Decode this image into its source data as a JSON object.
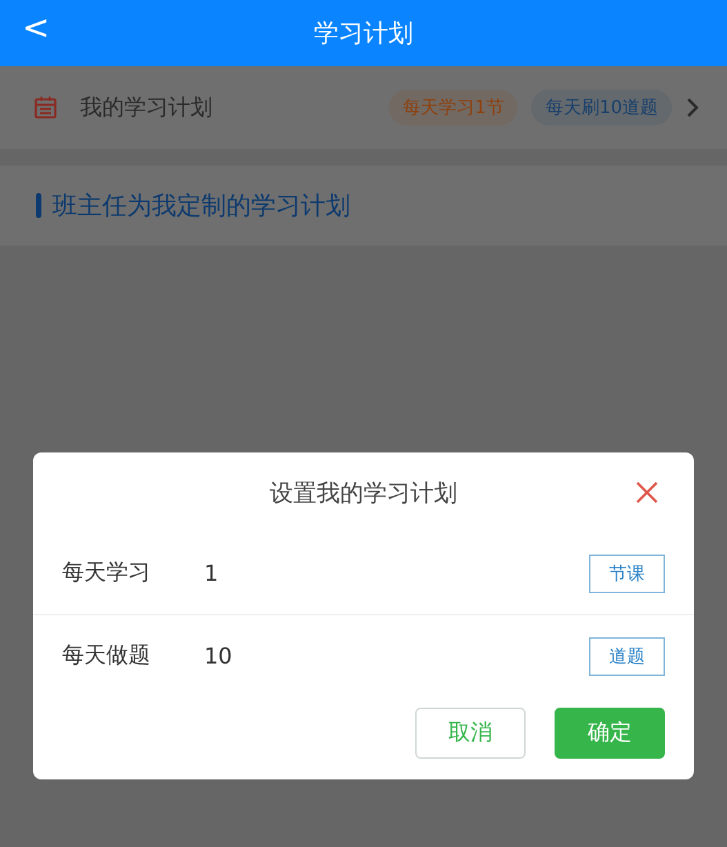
{
  "header": {
    "back": "<",
    "title": "学习计划"
  },
  "my_plan": {
    "label": "我的学习计划",
    "tags": [
      {
        "text": "每天学习1节",
        "color": "#8f3f0c"
      },
      {
        "text": "每天刷10道题",
        "color": "#173f6b"
      }
    ]
  },
  "section": {
    "title": "班主任为我定制的学习计划"
  },
  "dialog": {
    "title": "设置我的学习计划",
    "rows": [
      {
        "label": "每天学习",
        "value": "1",
        "unit": "节课"
      },
      {
        "label": "每天做题",
        "value": "10",
        "unit": "道题"
      }
    ],
    "buttons": [
      {
        "label": "取消",
        "kind": "secondary"
      },
      {
        "label": "确定",
        "kind": "primary"
      }
    ]
  }
}
